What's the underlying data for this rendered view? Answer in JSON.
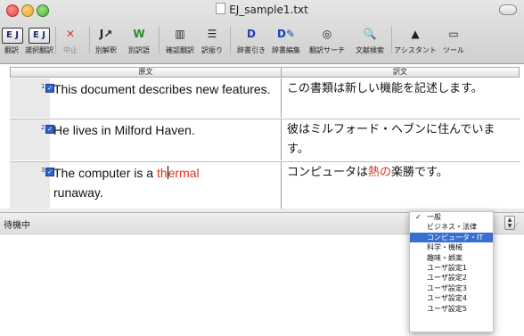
{
  "window": {
    "title": "EJ_sample1.txt"
  },
  "toolbar": {
    "items": [
      {
        "label": "翻訳",
        "icon": "ej-translate-icon",
        "glyph": "E↓J",
        "dim": false
      },
      {
        "label": "選択翻訳",
        "icon": "ej-select-translate-icon",
        "glyph": "E↓J",
        "dim": false
      },
      {
        "label": "中止",
        "icon": "stop-x-icon",
        "glyph": "✕",
        "dim": true
      },
      {
        "label": "別解釈",
        "icon": "alternate-interpretation-icon",
        "glyph": "J↗",
        "dim": false
      },
      {
        "label": "別訳語",
        "icon": "alternate-word-icon",
        "glyph": "W",
        "dim": false
      },
      {
        "label": "確認翻訳",
        "icon": "confirm-translate-icon",
        "glyph": "▥",
        "dim": false
      },
      {
        "label": "訳振り",
        "icon": "interlinear-icon",
        "glyph": "☰",
        "dim": false
      },
      {
        "label": "辞書引き",
        "icon": "dictionary-lookup-icon",
        "glyph": "D",
        "dim": false
      },
      {
        "label": "辞書編集",
        "icon": "dictionary-edit-icon",
        "glyph": "D✎",
        "dim": false
      },
      {
        "label": "翻訳サーチ",
        "icon": "translation-search-icon",
        "glyph": "◎",
        "dim": false
      },
      {
        "label": "文献検索",
        "icon": "literature-search-icon",
        "glyph": "🔍",
        "dim": false
      },
      {
        "label": "アシスタント",
        "icon": "assistant-icon",
        "glyph": "▲",
        "dim": false
      },
      {
        "label": "ツール",
        "icon": "tool-icon",
        "glyph": "▭",
        "dim": false
      }
    ]
  },
  "columns": {
    "source": "原文",
    "target": "訳文"
  },
  "rows": [
    {
      "num": "1",
      "src": "This document describes new features.",
      "tgt": "この書類は新しい機能を記述します。"
    },
    {
      "num": "2",
      "src": "He lives in Milford Haven.",
      "tgt": "彼はミルフォード・ヘブンに住んでいます。"
    },
    {
      "num": "3",
      "src_before": "The computer is a ",
      "src_hl_a": "th",
      "src_hl_b": "ermal",
      "src_after": "runaway.",
      "tgt_before": "コンピュータは",
      "tgt_hl": "熱の",
      "tgt_after": "楽勝です。"
    }
  ],
  "status": {
    "text": "待機中"
  },
  "menu": {
    "items": [
      {
        "label": "一般",
        "checked": true,
        "selected": false
      },
      {
        "label": "ビジネス・法律",
        "checked": false,
        "selected": false
      },
      {
        "label": "コンピュータ・IT",
        "checked": false,
        "selected": true
      },
      {
        "label": "科学・機械",
        "checked": false,
        "selected": false
      },
      {
        "label": "趣味・娯楽",
        "checked": false,
        "selected": false
      },
      {
        "label": "ユーザ設定1",
        "checked": false,
        "selected": false
      },
      {
        "label": "ユーザ設定2",
        "checked": false,
        "selected": false
      },
      {
        "label": "ユーザ設定3",
        "checked": false,
        "selected": false
      },
      {
        "label": "ユーザ設定4",
        "checked": false,
        "selected": false
      },
      {
        "label": "ユーザ設定5",
        "checked": false,
        "selected": false
      }
    ],
    "check_glyph": "✓"
  },
  "colors": {
    "highlight": "#e0321e",
    "selection": "#3a6fd2"
  }
}
